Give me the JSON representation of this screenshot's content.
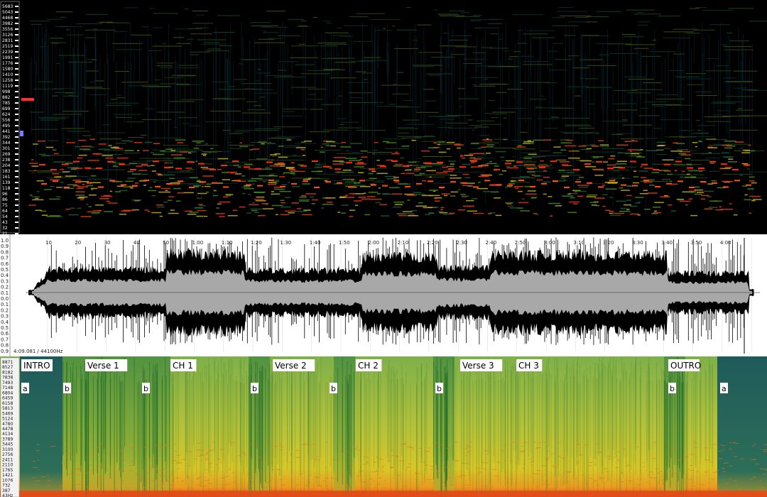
{
  "top_spectrogram": {
    "freq_labels": [
      "5683",
      "5043",
      "4468",
      "3982",
      "3556",
      "3126",
      "2831",
      "2519",
      "2239",
      "1991",
      "1776",
      "1580",
      "1410",
      "1258",
      "1119",
      "998",
      "882",
      "785",
      "699",
      "624",
      "556",
      "495",
      "441",
      "392",
      "344",
      "301",
      "269",
      "238",
      "204",
      "183",
      "161",
      "139",
      "118",
      "96",
      "86",
      "75",
      "64",
      "54",
      "43",
      "32",
      "21"
    ]
  },
  "waveform": {
    "amp_labels": [
      "1.0",
      "0.9",
      "0.8",
      "0.7",
      "0.6",
      "0.5",
      "0.4",
      "0.3",
      "0.2",
      "0.1",
      "0.0",
      "0.1",
      "0.2",
      "0.3",
      "0.4",
      "0.5",
      "0.6",
      "0.7",
      "0.8",
      "0.9"
    ],
    "time_labels": [
      "10",
      "20",
      "30",
      "40",
      "50",
      "1:00",
      "1:10",
      "1:20",
      "1:30",
      "1:40",
      "1:50",
      "2:00",
      "2:10",
      "2:20",
      "2:30",
      "2:40",
      "2:50",
      "3:00",
      "3:10",
      "3:20",
      "3:30",
      "3:40",
      "3:50",
      "4:00"
    ],
    "status": "4:09.081 / 44100Hz"
  },
  "bottom_spectrogram": {
    "freq_labels": [
      "8871",
      "8527",
      "8182",
      "7838",
      "7493",
      "7148",
      "6804",
      "6459",
      "6158",
      "5813",
      "5469",
      "5124",
      "4780",
      "4478",
      "4134",
      "3789",
      "3445",
      "3100",
      "2756",
      "2411",
      "2110",
      "1765",
      "1421",
      "1076",
      "732",
      "387",
      "43Hz"
    ],
    "sections": [
      "INTRO",
      "Verse 1",
      "CH 1",
      "Verse 2",
      "CH 2",
      "Verse 3",
      "CH 3",
      "OUTRO"
    ],
    "markers": [
      "a",
      "b",
      "b",
      "b",
      "b",
      "b",
      "b",
      "a"
    ]
  }
}
